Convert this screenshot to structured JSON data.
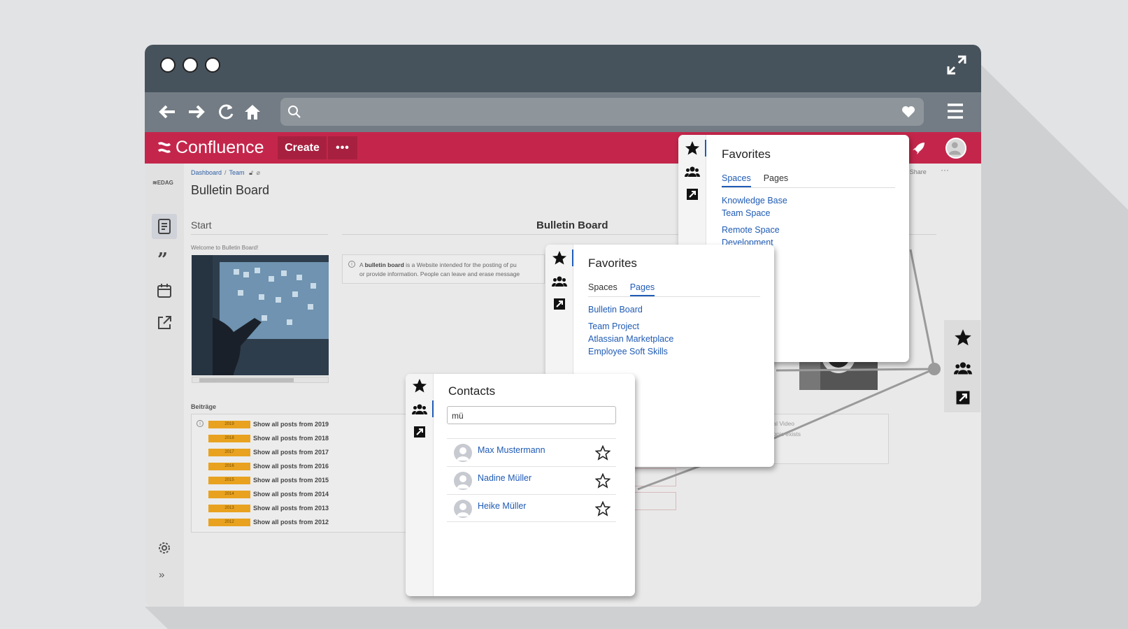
{
  "colors": {
    "titlebar": "#47535c",
    "navbar": "#737c84",
    "confluence_red": "#c4264b",
    "link_blue": "#1f5bb5",
    "tag_orange": "#e8a21f"
  },
  "browser": {
    "window_dots": [
      "close",
      "minimize",
      "maximize"
    ],
    "icons": [
      "back-arrow-icon",
      "forward-arrow-icon",
      "reload-icon",
      "home-icon",
      "search-icon",
      "heart-icon",
      "menu-icon",
      "expand-icon"
    ]
  },
  "header": {
    "app_name": "Confluence",
    "create_label": "Create",
    "more_label": "•••"
  },
  "page": {
    "breadcrumb": [
      "Dashboard",
      "Team"
    ],
    "title": "Bulletin Board",
    "share_label": "Share",
    "more_label": "···",
    "start_label": "Start",
    "main_heading": "Bulletin Board",
    "welcome_text": "Welcome to Bulletin Board!",
    "info_text_bold": "bulletin board",
    "info_text_line1_pre": "A ",
    "info_text_line1_post": " is a Website intended for the posting of pu",
    "info_text_line2": "or provide information. People can leave and erase message",
    "posts_heading": "Beiträge",
    "posts": [
      {
        "year": "2019",
        "label": "Show all posts from 2019"
      },
      {
        "year": "2018",
        "label": "Show all posts from 2018"
      },
      {
        "year": "2017",
        "label": "Show all posts from 2017"
      },
      {
        "year": "2016",
        "label": "Show all posts from 2016"
      },
      {
        "year": "2015",
        "label": "Show all posts from 2015"
      },
      {
        "year": "2014",
        "label": "Show all posts from 2014"
      },
      {
        "year": "2013",
        "label": "Show all posts from 2013"
      },
      {
        "year": "2012",
        "label": "Show all posts from 2012"
      }
    ],
    "video_lines": [
      "Tutorial Video",
      "your topic exists",
      "estion"
    ]
  },
  "favorites_spaces": {
    "title": "Favorites",
    "tabs": [
      "Spaces",
      "Pages"
    ],
    "active_tab": "Spaces",
    "items": [
      "Knowledge Base",
      "Team Space",
      "Remote Space",
      "Development"
    ]
  },
  "favorites_pages": {
    "title": "Favorites",
    "tabs": [
      "Spaces",
      "Pages"
    ],
    "active_tab": "Pages",
    "items": [
      "Bulletin Board",
      "Team Project",
      "Atlassian Marketplace",
      "Employee Soft Skills"
    ]
  },
  "contacts": {
    "title": "Contacts",
    "search_value": "mü",
    "people": [
      "Max Mustermann",
      "Nadine Müller",
      "Heike Müller"
    ]
  }
}
